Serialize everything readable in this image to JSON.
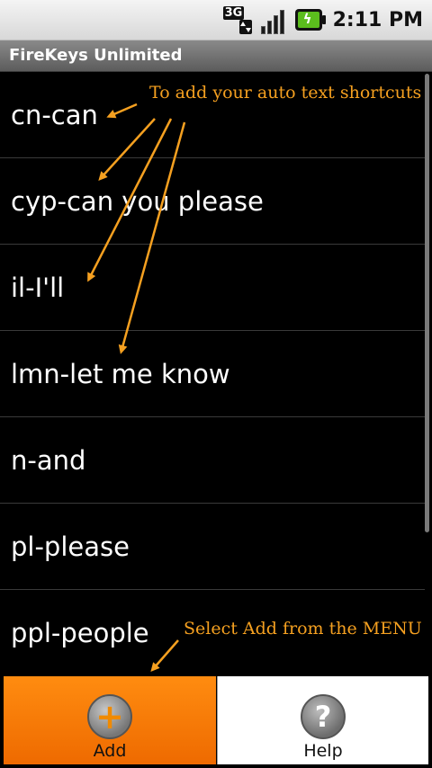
{
  "status_bar": {
    "network_label": "3G",
    "time": "2:11 PM",
    "icons": [
      "3g-data-icon",
      "signal-strength-icon",
      "battery-charging-icon"
    ]
  },
  "app": {
    "title": "FireKeys Unlimited"
  },
  "shortcuts": [
    {
      "label": "cn-can"
    },
    {
      "label": "cyp-can you please"
    },
    {
      "label": "il-I'll"
    },
    {
      "label": "lmn-let me know"
    },
    {
      "label": "n-and"
    },
    {
      "label": "pl-please"
    },
    {
      "label": "ppl-people"
    }
  ],
  "annotations": {
    "top": "To add your auto text shortcuts",
    "bottom": "Select Add from the MENU",
    "color": "#f5a020"
  },
  "menu": {
    "add_label": "Add",
    "help_label": "Help",
    "add_icon": "plus-circle-icon",
    "help_icon": "question-circle-icon",
    "add_color": "#ff7a00",
    "help_icon_glyph": "?",
    "add_icon_glyph": "+"
  }
}
